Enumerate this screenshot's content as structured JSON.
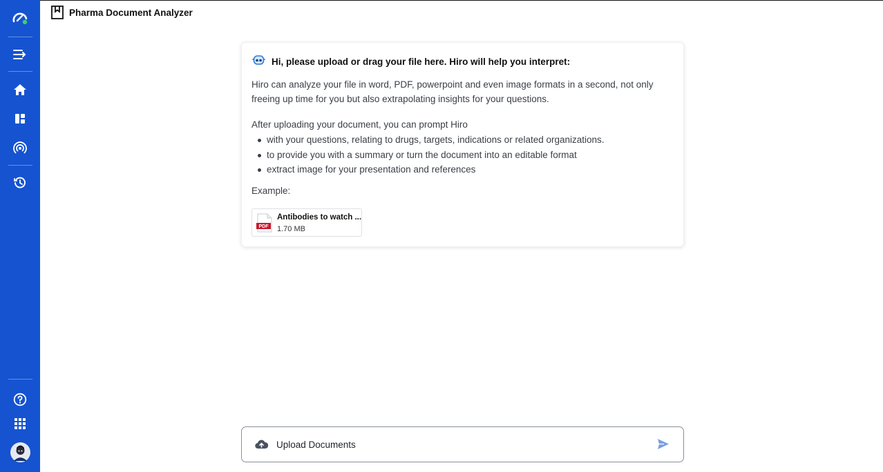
{
  "header": {
    "title": "Pharma Document Analyzer",
    "icon": "bookmark-icon"
  },
  "sidebar": {
    "items": [
      {
        "name": "logo",
        "icon": "speedometer-logo-icon"
      },
      {
        "name": "collapse",
        "icon": "menu-collapse-icon"
      },
      {
        "name": "home",
        "icon": "home-icon"
      },
      {
        "name": "dashboard",
        "icon": "dashboard-icon"
      },
      {
        "name": "broadcast",
        "icon": "signal-icon"
      },
      {
        "name": "history",
        "icon": "history-icon"
      },
      {
        "name": "help",
        "icon": "help-icon"
      },
      {
        "name": "apps",
        "icon": "apps-grid-icon"
      },
      {
        "name": "avatar",
        "icon": "user-avatar"
      }
    ]
  },
  "card": {
    "heading": "Hi, please upload or drag your file here. Hiro will help you interpret:",
    "para1": "Hiro can analyze your file in word, PDF, powerpoint and even image formats in a second, not only freeing up time for you but also extrapolating insights for your questions.",
    "para2": "After uploading your document, you can prompt Hiro",
    "bullets": [
      "with your questions, relating to drugs, targets, indications or related organizations.",
      "to provide you with a summary or turn the document into an editable format",
      "extract image for your presentation and references"
    ],
    "example_label": "Example:",
    "example_file": {
      "name": "Antibodies to watch ...",
      "size": "1.70 MB",
      "type_badge": "PDF"
    }
  },
  "input": {
    "label": "Upload Documents"
  },
  "colors": {
    "sidebar": "#1553d1",
    "accent": "#4a7fe0",
    "pdf_red": "#c8192d"
  }
}
